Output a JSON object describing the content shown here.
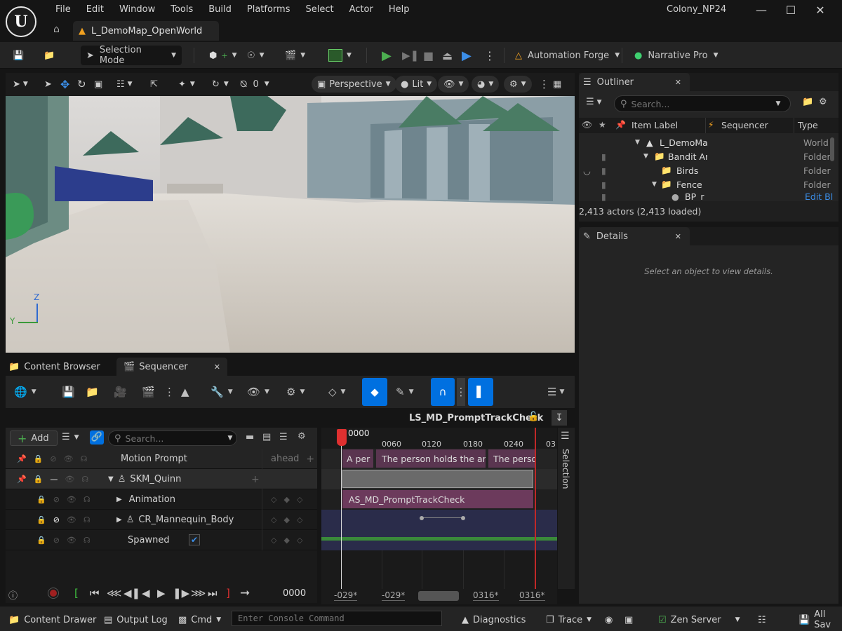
{
  "menu": [
    "File",
    "Edit",
    "Window",
    "Tools",
    "Build",
    "Platforms",
    "Select",
    "Actor",
    "Help"
  ],
  "project_name": "Colony_NP24",
  "map_tab": "L_DemoMap_OpenWorld",
  "toolbar": {
    "selection_mode": "Selection Mode",
    "automation_forge": "Automation Forge",
    "narrative_pro": "Narrative Pro"
  },
  "viewport": {
    "snap_value": "0",
    "perspective": "Perspective",
    "lit": "Lit",
    "axis_z": "Z",
    "axis_y": "Y"
  },
  "bottom_tabs": {
    "content_browser": "Content Browser",
    "sequencer": "Sequencer"
  },
  "sequencer": {
    "sequence_name": "LS_MD_PromptTrackCheck",
    "add_label": "Add",
    "search_placeholder": "Search...",
    "header_column": "Motion Prompt",
    "ahead_label": "ahead",
    "tracks": [
      {
        "label": "SKM_Quinn"
      },
      {
        "label": "Animation"
      },
      {
        "label": "CR_Mannequin_Body"
      },
      {
        "label": "Spawned"
      }
    ],
    "current_frame": "0000",
    "playhead_frame": "0000",
    "ticks": [
      "0060",
      "0120",
      "0180",
      "0240",
      "03"
    ],
    "prompt_segments": [
      "A per",
      "The person holds the arm",
      "The perso"
    ],
    "anim_clip": "AS_MD_PromptTrackCheck",
    "range_labels": [
      "-029*",
      "-029*",
      "0316*",
      "0316*"
    ],
    "selection_label": "Selection"
  },
  "outliner": {
    "tab": "Outliner",
    "search_placeholder": "Search...",
    "columns": {
      "label": "Item Label",
      "sequencer": "Sequencer",
      "type": "Type"
    },
    "rows": [
      {
        "label": "L_DemoMa",
        "type": "World"
      },
      {
        "label": "Bandit Ar",
        "type": "Folder"
      },
      {
        "label": "Birds",
        "type": "Folder"
      },
      {
        "label": "Fence",
        "type": "Folder"
      },
      {
        "label": "BP_r",
        "type": "Edit Bl"
      }
    ],
    "count": "2,413 actors (2,413 loaded)"
  },
  "details": {
    "tab": "Details",
    "empty_text": "Select an object to view details."
  },
  "statusbar": {
    "content_drawer": "Content Drawer",
    "output_log": "Output Log",
    "cmd": "Cmd",
    "console_placeholder": "Enter Console Command",
    "diagnostics": "Diagnostics",
    "trace": "Trace",
    "zen_server": "Zen Server",
    "all_saved": "All Sav"
  },
  "colors": {
    "accent_blue": "#0070e0",
    "play_green": "#4caf50",
    "clip_purple": "#6c3a5c",
    "playhead_red": "#e03030"
  }
}
